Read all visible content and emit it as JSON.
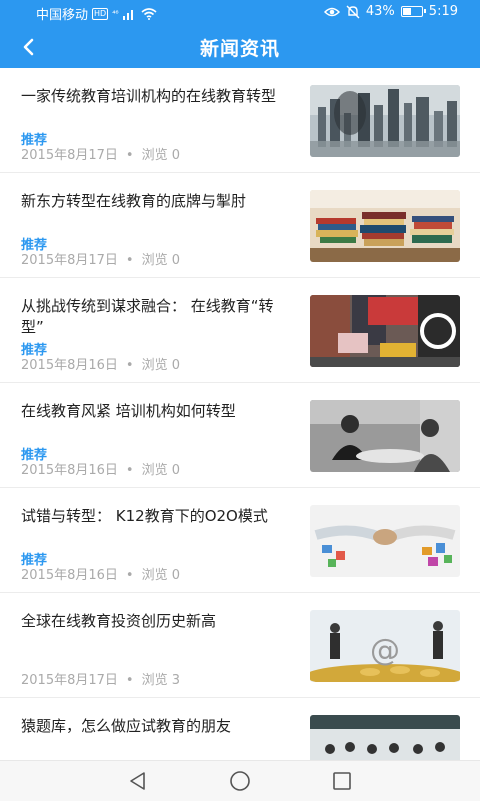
{
  "status": {
    "carrier": "中国移动",
    "hd": "HD",
    "signal": "⁴⁶",
    "battery": "43%",
    "time": "5:19",
    "battery_level": 0.43
  },
  "header": {
    "title": "新闻资讯"
  },
  "news": [
    {
      "title": "一家传统教育培训机构的在线教育转型",
      "tag": "推荐",
      "date": "2015年8月17日",
      "views": "浏览 0",
      "image": "city-skyline-image"
    },
    {
      "title": "新东方转型在线教育的底牌与掣肘",
      "tag": "推荐",
      "date": "2015年8月17日",
      "views": "浏览 0",
      "image": "books-image"
    },
    {
      "title": "从挑战传统到谋求融合：  在线教育“转型”",
      "tag": "推荐",
      "date": "2015年8月16日",
      "views": "浏览 0",
      "image": "street-ads-image"
    },
    {
      "title": "在线教育风紧 培训机构如何转型",
      "tag": "推荐",
      "date": "2015年8月16日",
      "views": "浏览 0",
      "image": "meeting-image"
    },
    {
      "title": "试错与转型：  K12教育下的O2O模式",
      "tag": "推荐",
      "date": "2015年8月16日",
      "views": "浏览 0",
      "image": "handshake-image"
    },
    {
      "title": "全球在线教育投资创历史新高",
      "tag": "",
      "date": "2015年8月17日",
      "views": "浏览 3",
      "image": "coins-image"
    },
    {
      "title": "猿题库，怎么做应试教育的朋友",
      "tag": "",
      "date": "",
      "views": "",
      "image": "classroom-image"
    }
  ],
  "colors": {
    "accent": "#2c98f0"
  }
}
